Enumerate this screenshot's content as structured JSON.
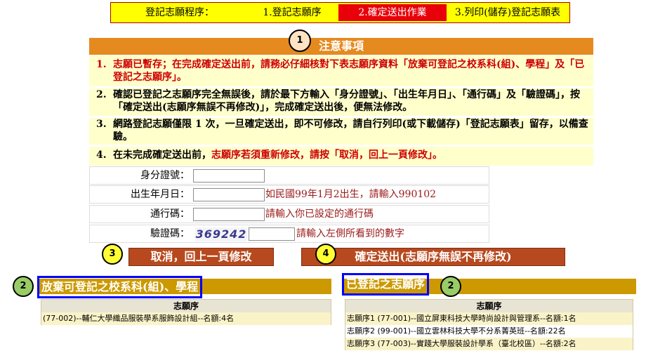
{
  "steps": {
    "label": "登記志願程序：",
    "items": [
      "1.登記志願序",
      "2.確定送出作業",
      "3.列印(儲存)登記志願表"
    ]
  },
  "notice": {
    "circle": "1",
    "title": "注意事項",
    "items": [
      {
        "num": "1.",
        "text": "志願已暫存；在完成確定送出前，請務必仔細核對下表志願序資料「放棄可登記之校系科(組)、學程」及「已登記之志願序」。"
      },
      {
        "num": "2.",
        "text": "確認已登記之志願序完全無誤後，請於最下方輸入「身分證號」、「出生年月日」、「通行碼」及「驗證碼」，按「確定送出(志願序無誤不再修改)」，完成確定送出後，便無法修改。"
      },
      {
        "num": "3.",
        "text": "網路登記志願僅限 1 次，一旦確定送出，即不可修改，請自行列印(或下載儲存)「登記志願表」留存，以備查驗。"
      },
      {
        "num": "4.",
        "pre": "在未完成確定送出前，",
        "red": "志願序若須重新修改，請按「取消，回上一頁修改」。"
      }
    ]
  },
  "form": {
    "id_label": "身分證號：",
    "id_value": "",
    "birth_label": "出生年月日：",
    "birth_value": "",
    "birth_hint": "如民國99年1月2出生，請輸入990102",
    "pass_label": "通行碼：",
    "pass_value": "",
    "pass_hint": "請輸入你已設定的通行碼",
    "captcha_label": "驗證碼：",
    "captcha_code": "369242",
    "captcha_value": "",
    "captcha_hint": "請輸入左側所看到的數字"
  },
  "actions": {
    "cancel_circle": "3",
    "cancel_label": "取消，回上一頁修改",
    "submit_circle": "4",
    "submit_label": "確定送出(志願序無誤不再修改)"
  },
  "giveup": {
    "circle": "2",
    "title": "放棄可登記之校系科(組)、學程",
    "header": "志願序",
    "rows": [
      "(77-002)--輔仁大學織品服裝學系服飾設計組--名額:4名"
    ]
  },
  "registered": {
    "circle": "2",
    "title": "已登記之志願序",
    "header": "志願序",
    "rows": [
      "志願序1 (77-001)--國立屏東科技大學時尚設計與管理系--名額:1名",
      "志願序2 (99-001)--國立雲林科技大學不分系菁英班--名額:22名",
      "志願序3 (77-003)--實踐大學服裝設計學系（臺北校區）--名額:2名"
    ]
  },
  "colors": {
    "accent_orange": "#e58a1f",
    "active_step": "#e8000a",
    "button_brown": "#b8491f",
    "section_gold": "#cc9900"
  }
}
